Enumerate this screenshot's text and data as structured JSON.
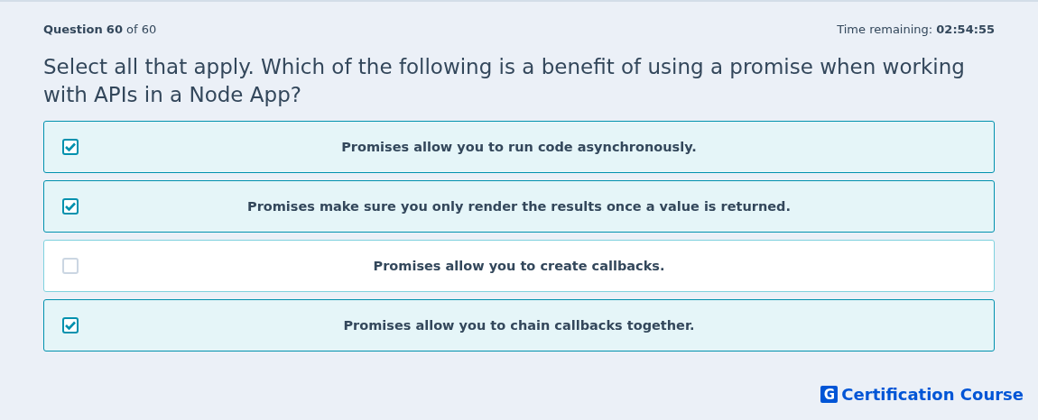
{
  "progress": {
    "label": "Question",
    "current": "60",
    "of": "of 60"
  },
  "timer": {
    "label": "Time remaining:",
    "value": "02:54:55"
  },
  "question": "Select all that apply. Which of the following is a benefit of using a promise when working with APIs in a Node App?",
  "options": [
    {
      "text": "Promises allow you to run code asynchronously.",
      "checked": true
    },
    {
      "text": "Promises make sure you only render the results once a value is returned.",
      "checked": true
    },
    {
      "text": "Promises allow you to create callbacks.",
      "checked": false
    },
    {
      "text": "Promises allow you to chain callbacks together.",
      "checked": true
    }
  ],
  "brand": {
    "mark": "G",
    "name": "Certification Course"
  }
}
